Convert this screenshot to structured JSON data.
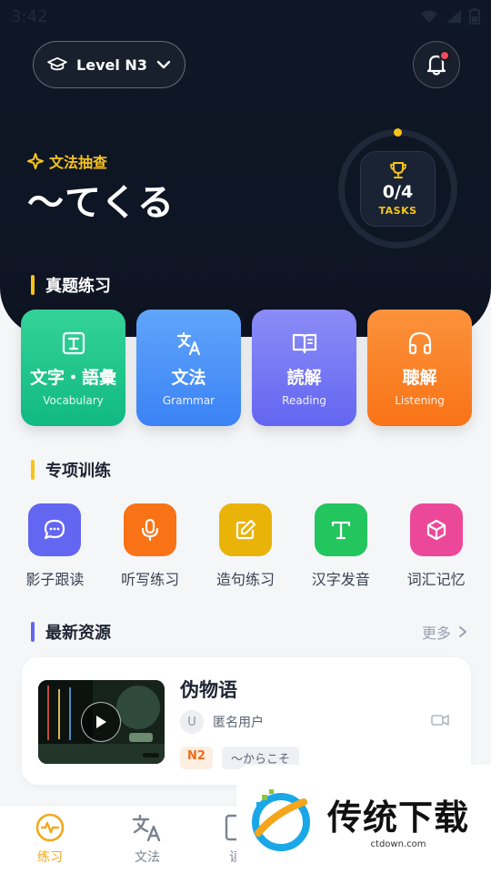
{
  "status": {
    "time": "3:42"
  },
  "header": {
    "level": "Level N3",
    "notification_badge": true
  },
  "daily": {
    "label": "文法抽查",
    "grammar": "〜てくる",
    "tasks_count": "0/4",
    "tasks_label": "TASKS",
    "progress": 0
  },
  "practice": {
    "title": "真题练习",
    "cards": [
      {
        "title": "文字・語彙",
        "subtitle": "Vocabulary",
        "icon": "text-box-icon",
        "color": "#10b981"
      },
      {
        "title": "文法",
        "subtitle": "Grammar",
        "icon": "translate-icon",
        "color": "#3b82f6"
      },
      {
        "title": "読解",
        "subtitle": "Reading",
        "icon": "book-open-icon",
        "color": "#6366f1"
      },
      {
        "title": "聴解",
        "subtitle": "Listening",
        "icon": "headphones-icon",
        "color": "#f97316"
      }
    ]
  },
  "training": {
    "title": "专项训练",
    "items": [
      {
        "label": "影子跟读",
        "icon": "chat-bubble-icon",
        "color": "#6366f1"
      },
      {
        "label": "听写练习",
        "icon": "microphone-icon",
        "color": "#f97316"
      },
      {
        "label": "造句练习",
        "icon": "edit-icon",
        "color": "#eab308"
      },
      {
        "label": "汉字发音",
        "icon": "letter-t-icon",
        "color": "#22c55e"
      },
      {
        "label": "词汇记忆",
        "icon": "cube-icon",
        "color": "#ec4899"
      }
    ]
  },
  "resources": {
    "title": "最新资源",
    "more": "更多",
    "items": [
      {
        "title": "伪物语",
        "avatar_letter": "U",
        "author": "匿名用户",
        "level": "N2",
        "grammar_tag": "〜からこそ"
      }
    ]
  },
  "nav": {
    "items": [
      {
        "label": "练习",
        "icon": "activity-icon",
        "active": true
      },
      {
        "label": "文法",
        "icon": "translate-icon",
        "active": false
      },
      {
        "label": "读",
        "icon": "book-icon",
        "active": false
      }
    ]
  },
  "watermark": {
    "brand": "传统下载",
    "domain": "ctdown.com"
  },
  "colors": {
    "accent": "#f7c31a",
    "dark": "#0f1726"
  }
}
